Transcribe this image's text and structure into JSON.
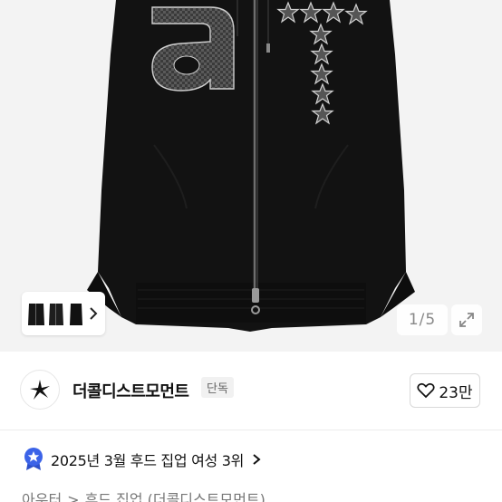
{
  "gallery": {
    "counter": "1/5",
    "thumbnail_count": 3
  },
  "shop": {
    "name": "더콜디스트모먼트",
    "badge": "단독",
    "like_count": "23만"
  },
  "ranking": {
    "text": "2025년 3월 후드 집업 여성 3위"
  },
  "breadcrumb": {
    "level1": "아우터",
    "separator": ">",
    "level2": "후드 집업 (더콜디스트모먼트)"
  },
  "colors": {
    "background": "#ffffff",
    "image_bg": "#f3f3f3",
    "jacket": "#121212",
    "rank_badge": "#3b63e8"
  }
}
